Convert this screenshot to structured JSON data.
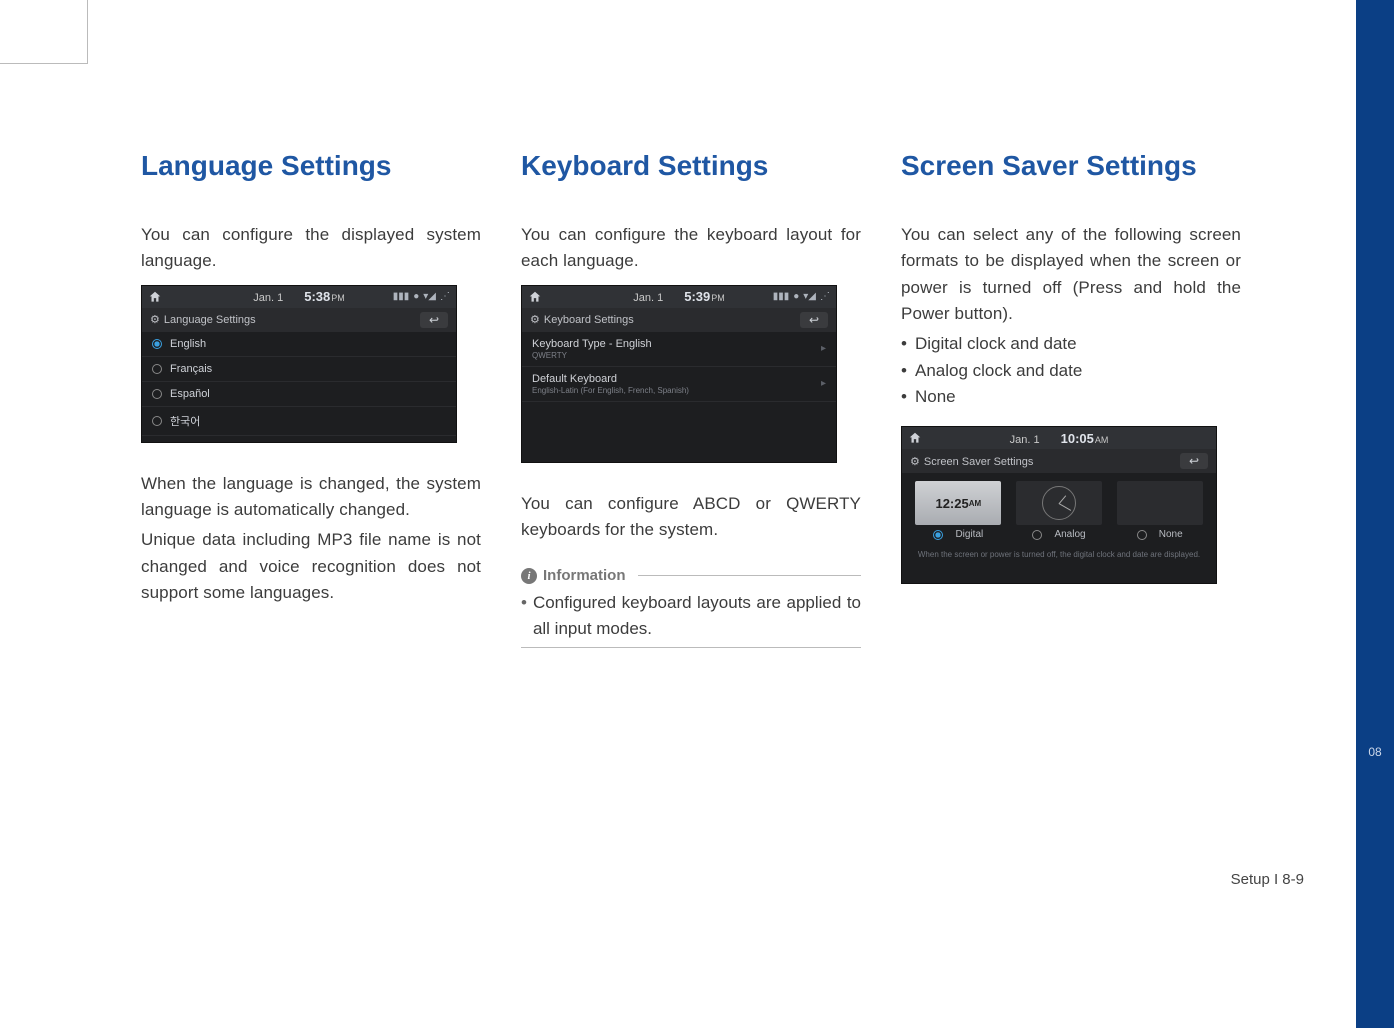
{
  "page": {
    "section_tab": "08",
    "footer": "Setup I 8-9"
  },
  "col1": {
    "heading": "Language Settings",
    "p1": "You can configure the displayed system language.",
    "p2": "When the language is changed, the system language is automatically changed.",
    "p3": "Unique data including MP3 file name is not changed and voice recognition does not support some languages.",
    "screenshot": {
      "date": "Jan.  1",
      "time": "5:38",
      "ampm": "PM",
      "title": "Language Settings",
      "options": [
        {
          "label": "English",
          "selected": true
        },
        {
          "label": "Français",
          "selected": false
        },
        {
          "label": "Español",
          "selected": false
        },
        {
          "label": "한국어",
          "selected": false
        }
      ]
    }
  },
  "col2": {
    "heading": "Keyboard Settings",
    "p1": "You can configure the keyboard layout for each language.",
    "p2": "You can configure ABCD or QWERTY keyboards for the system.",
    "info_label": "Information",
    "info_item": "Configured keyboard layouts are applied to all input modes.",
    "screenshot": {
      "date": "Jan.  1",
      "time": "5:39",
      "ampm": "PM",
      "title": "Keyboard Settings",
      "items": [
        {
          "label": "Keyboard Type - English",
          "sub": "QWERTY"
        },
        {
          "label": "Default Keyboard",
          "sub": "English-Latin (For English, French, Spanish)"
        }
      ]
    }
  },
  "col3": {
    "heading": "Screen Saver Settings",
    "p1": "You can select any of the following screen formats to be displayed when the screen or power is turned off (Press and hold the Power button).",
    "bullets": [
      "Digital clock and date",
      "Analog clock and date",
      "None"
    ],
    "screenshot": {
      "date": "Jan.  1",
      "time": "10:05",
      "ampm": "AM",
      "title": "Screen Saver Settings",
      "options": [
        {
          "label": "Digital",
          "preview_time": "12:25",
          "preview_ampm": "AM",
          "selected": true
        },
        {
          "label": "Analog",
          "selected": false
        },
        {
          "label": "None",
          "selected": false
        }
      ],
      "note": "When the screen or power is turned off, the digital clock and date are displayed."
    }
  }
}
